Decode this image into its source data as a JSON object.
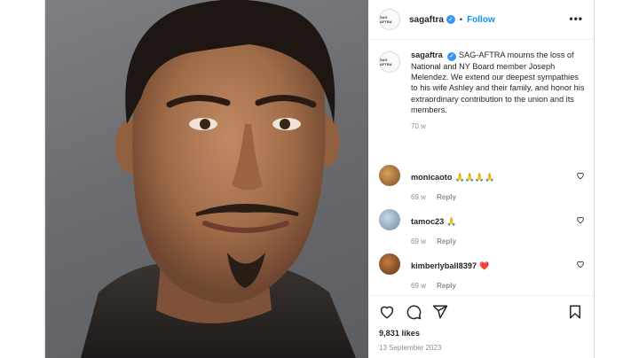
{
  "post": {
    "username": "sagaftra",
    "follow_label": "Follow",
    "dot": "•",
    "more_label": "•••",
    "avatar_text": "SAG AFTRA",
    "caption_username": "sagaftra",
    "caption_text": "SAG-AFTRA mourns the loss of National and NY Board member Joseph Melendez. We extend our deepest sympathies to his wife Ashley and their family, and honor his extraordinary contribution to the union and its members.",
    "caption_age": "70 w",
    "likes": "9,831 likes",
    "date": "13 September 2023"
  },
  "comments": [
    {
      "username": "monicaoto",
      "emoji": "🙏🙏🙏🙏",
      "age": "69 w",
      "reply": "Reply",
      "avatar_color": "#b07a45"
    },
    {
      "username": "tamoc23",
      "emoji": "🙏",
      "age": "69 w",
      "reply": "Reply",
      "avatar_color": "#8fa7bd"
    },
    {
      "username": "kimberlyball8397",
      "emoji": "❤️",
      "age": "69 w",
      "reply": "Reply",
      "avatar_color": "#9a5a2c"
    }
  ],
  "icons": {
    "verified": "verified-badge-icon",
    "like": "heart-icon",
    "comment": "comment-icon",
    "share": "share-icon",
    "save": "bookmark-icon",
    "options": "more-options-icon"
  },
  "colors": {
    "follow": "#0095f6",
    "verified": "#3897f0",
    "muted": "#8e8e8e"
  }
}
